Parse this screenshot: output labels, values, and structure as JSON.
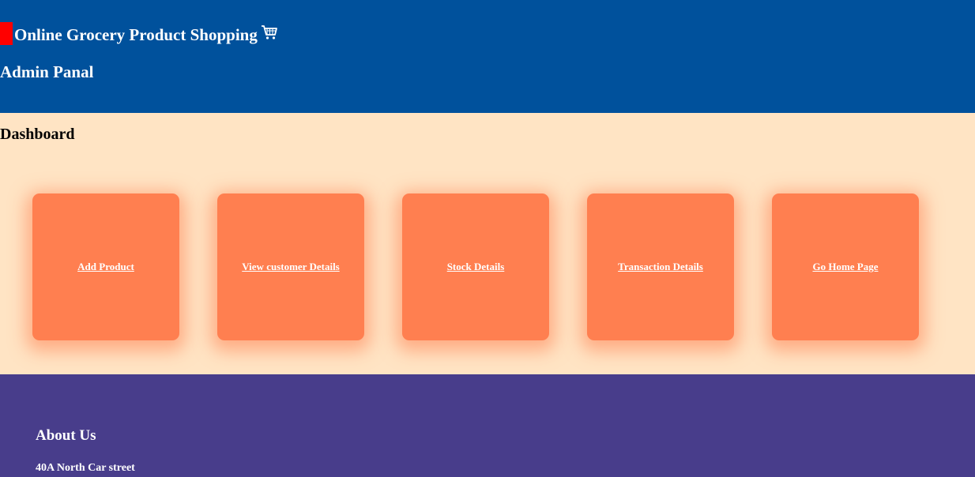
{
  "header": {
    "title": "Online Grocery Product Shopping",
    "subtitle": "Admin Panal",
    "title_icon": "shopping-cart-icon",
    "background": "#00519c",
    "mark_color": "#ff0000"
  },
  "dashboard": {
    "title": "Dashboard",
    "background": "#ffe4c4",
    "card_color": "#ff7f50",
    "cards": [
      {
        "label": "Add Product"
      },
      {
        "label": "View customer Details"
      },
      {
        "label": "Stock Details"
      },
      {
        "label": "Transaction Details"
      },
      {
        "label": "Go Home Page"
      }
    ]
  },
  "footer": {
    "title": "About Us",
    "address": "40A North Car street",
    "background": "#483d8b"
  }
}
